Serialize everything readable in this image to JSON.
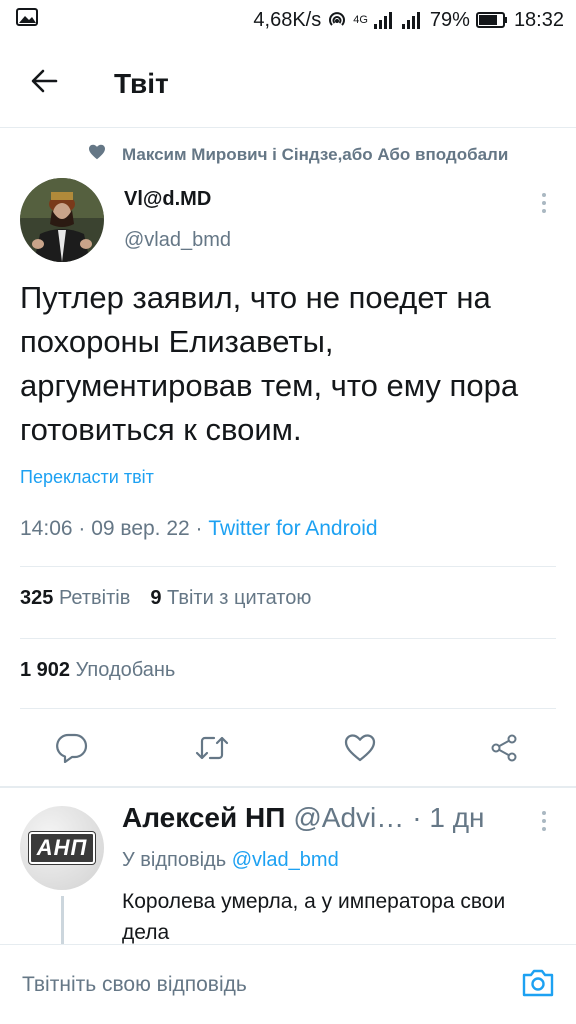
{
  "status_bar": {
    "network_speed": "4,68K/s",
    "network_type": "4G",
    "battery": "79%",
    "time": "18:32",
    "icons": [
      "image-notification-icon",
      "hotspot-icon",
      "signal-icon",
      "signal-icon-2",
      "battery-icon"
    ]
  },
  "header": {
    "title": "Твіт",
    "back_icon": "arrow-left-icon"
  },
  "liked_by": {
    "text": "Максим Мирович і Сіндзе,або Або вподобали",
    "icon": "heart-filled-icon"
  },
  "tweet": {
    "author_name": "Vl@d.MD",
    "author_handle": "@vlad_bmd",
    "text": "Путлер заявил, что не поедет на похороны Елизаветы, аргументировав тем, что ему пора готовиться к своим.",
    "translate_label": "Перекласти твіт",
    "timestamp": "14:06 · 09 вер. 22 · ",
    "source": "Twitter for Android",
    "retweets_count": "325",
    "retweets_label": "Ретвітів",
    "quotes_count": "9",
    "quotes_label": "Твіти з цитатою",
    "likes_count": "1 902",
    "likes_label": "Уподобань"
  },
  "actions": [
    {
      "name": "reply",
      "icon": "comment-icon"
    },
    {
      "name": "retweet",
      "icon": "retweet-icon"
    },
    {
      "name": "like",
      "icon": "heart-icon"
    },
    {
      "name": "share",
      "icon": "share-icon"
    }
  ],
  "reply": {
    "avatar_text": "АНП",
    "author_name": "Алексей НП",
    "author_handle": "@Advi…",
    "time": "· 1 дн",
    "reply_to_label": "У відповідь",
    "reply_to_handle": "@vlad_bmd",
    "text": "Королева умерла, а у императора свои дела"
  },
  "compose": {
    "placeholder": "Твітніть свою відповідь",
    "camera_icon": "camera-icon"
  },
  "colors": {
    "accent": "#1da1f2",
    "secondary_text": "#657786",
    "divider": "#e6ecf0"
  }
}
